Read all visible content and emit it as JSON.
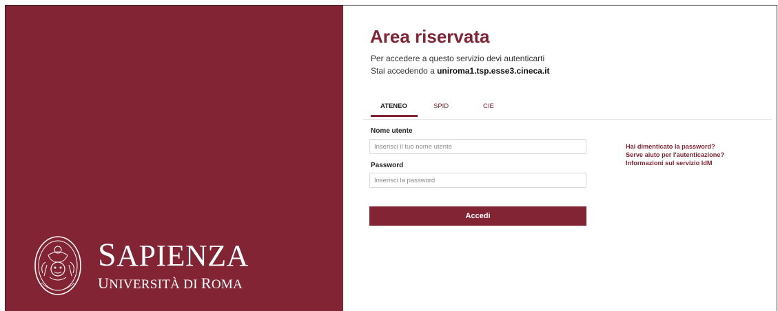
{
  "brand": {
    "name": "Sapienza",
    "subtitle": "Università di Roma",
    "panel_color": "#822433"
  },
  "header": {
    "title": "Area riservata",
    "line1": "Per accedere a questo servizio devi autenticarti",
    "line2_prefix": "Stai accedendo a",
    "line2_host": "uniroma1.tsp.esse3.cineca.it"
  },
  "tabs": [
    {
      "label": "ATENEO",
      "active": true
    },
    {
      "label": "SPID",
      "active": false
    },
    {
      "label": "CIE",
      "active": false
    }
  ],
  "form": {
    "username_label": "Nome utente",
    "username_placeholder": "Inserisci il tuo nome utente",
    "password_label": "Password",
    "password_placeholder": "Inserisci la password",
    "submit_label": "Accedi"
  },
  "help_links": [
    "Hai dimenticato la password?",
    "Serve aiuto per l'autenticazione?",
    "Informazioni sul servizio IdM"
  ]
}
